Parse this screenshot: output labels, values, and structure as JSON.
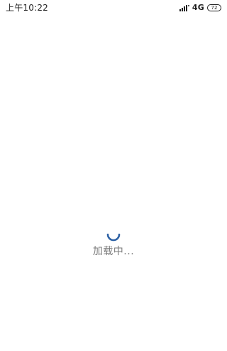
{
  "status_bar": {
    "time": "上午10:22",
    "network": "4G",
    "battery": "72",
    "icons": {
      "signal": "signal-icon",
      "battery": "battery-icon"
    }
  },
  "loading": {
    "text": "加载中...",
    "spinner_color": "#2f63a6"
  }
}
